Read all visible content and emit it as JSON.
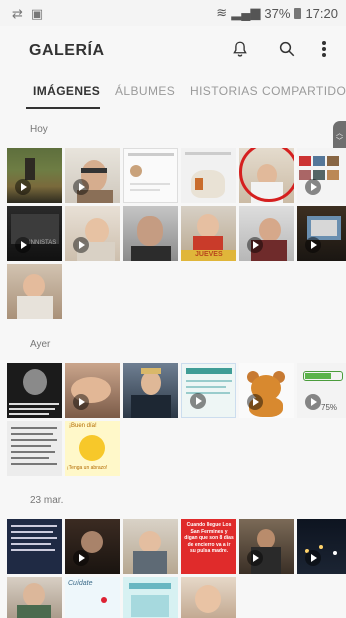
{
  "status_bar": {
    "left_icons": [
      "transfer-icon",
      "gallery-notification-icon"
    ],
    "battery": "37%",
    "time": "17:20"
  },
  "app": {
    "title": "GALERÍA"
  },
  "tabs": [
    {
      "label": "IMÁGENES",
      "active": true
    },
    {
      "label": "ÁLBUMES",
      "active": false
    },
    {
      "label": "HISTORIAS",
      "active": false
    },
    {
      "label": "COMPARTIDO",
      "active": false
    }
  ],
  "sections": [
    {
      "label": "Hoy"
    },
    {
      "label": "Ayer"
    },
    {
      "label": "23 mar."
    }
  ],
  "thumb_text": {
    "pizarra": "INNISTAS",
    "jueves": "JUEVES",
    "percentage": "75%",
    "buenos_dias": "¡Buen día!",
    "abrazo": "¡Tenga un abrazo!",
    "sanfermines": "Cuando llegue Los San Fermines y digan que son 8 días de encierro va a ir su pulsa madre.",
    "cuidate": "Cuídate"
  },
  "colors": {
    "accent": "#d51f1f",
    "text_primary": "#333333",
    "text_secondary": "#9a9a9a"
  }
}
